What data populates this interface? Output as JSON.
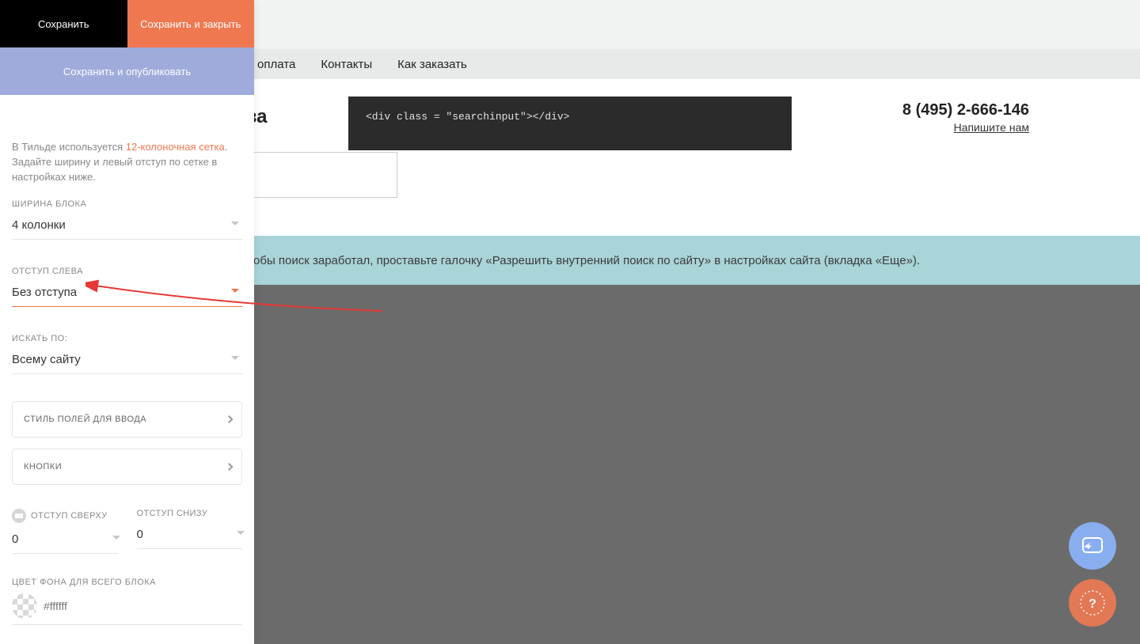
{
  "sidebar": {
    "save": "Сохранить",
    "saveClose": "Сохранить и закрыть",
    "savePublish": "Сохранить и опубликовать",
    "help": {
      "prefix": "В Тильде используется ",
      "link": "12-колоночная сетка",
      "suffix": ". Задайте ширину и левый отступ по сетке в настройках ниже."
    },
    "blockWidth": {
      "label": "ШИРИНА БЛОКА",
      "value": "4 колонки"
    },
    "offsetLeft": {
      "label": "ОТСТУП СЛЕВА",
      "value": "Без отступа"
    },
    "searchBy": {
      "label": "ИСКАТЬ ПО:",
      "value": "Всему сайту"
    },
    "inputStyle": "СТИЛЬ ПОЛЕЙ ДЛЯ ВВОДА",
    "buttons": "КНОПКИ",
    "spacingTop": {
      "label": "ОТСТУП СВЕРХУ",
      "value": "0"
    },
    "spacingBottom": {
      "label": "ОТСТУП СНИЗУ",
      "value": "0"
    },
    "bgColor": {
      "label": "ЦВЕТ ФОНА ДЛЯ ВСЕГО БЛОКА",
      "placeholder": "#ffffff"
    }
  },
  "topnav": {
    "item1": "а и оплата",
    "item2": "Контакты",
    "item3": "Как заказать"
  },
  "content": {
    "city": "осква",
    "code": "<div class = \"searchinput\"></div>",
    "phone": "8 (495) 2-666-146",
    "writeUs": "Напишите нам"
  },
  "blueStrip": "lтобы поиск заработал, проставьте галочку «Разрешить внутренний поиск по сайту» в настройках сайта (вкладка «Еще»)."
}
